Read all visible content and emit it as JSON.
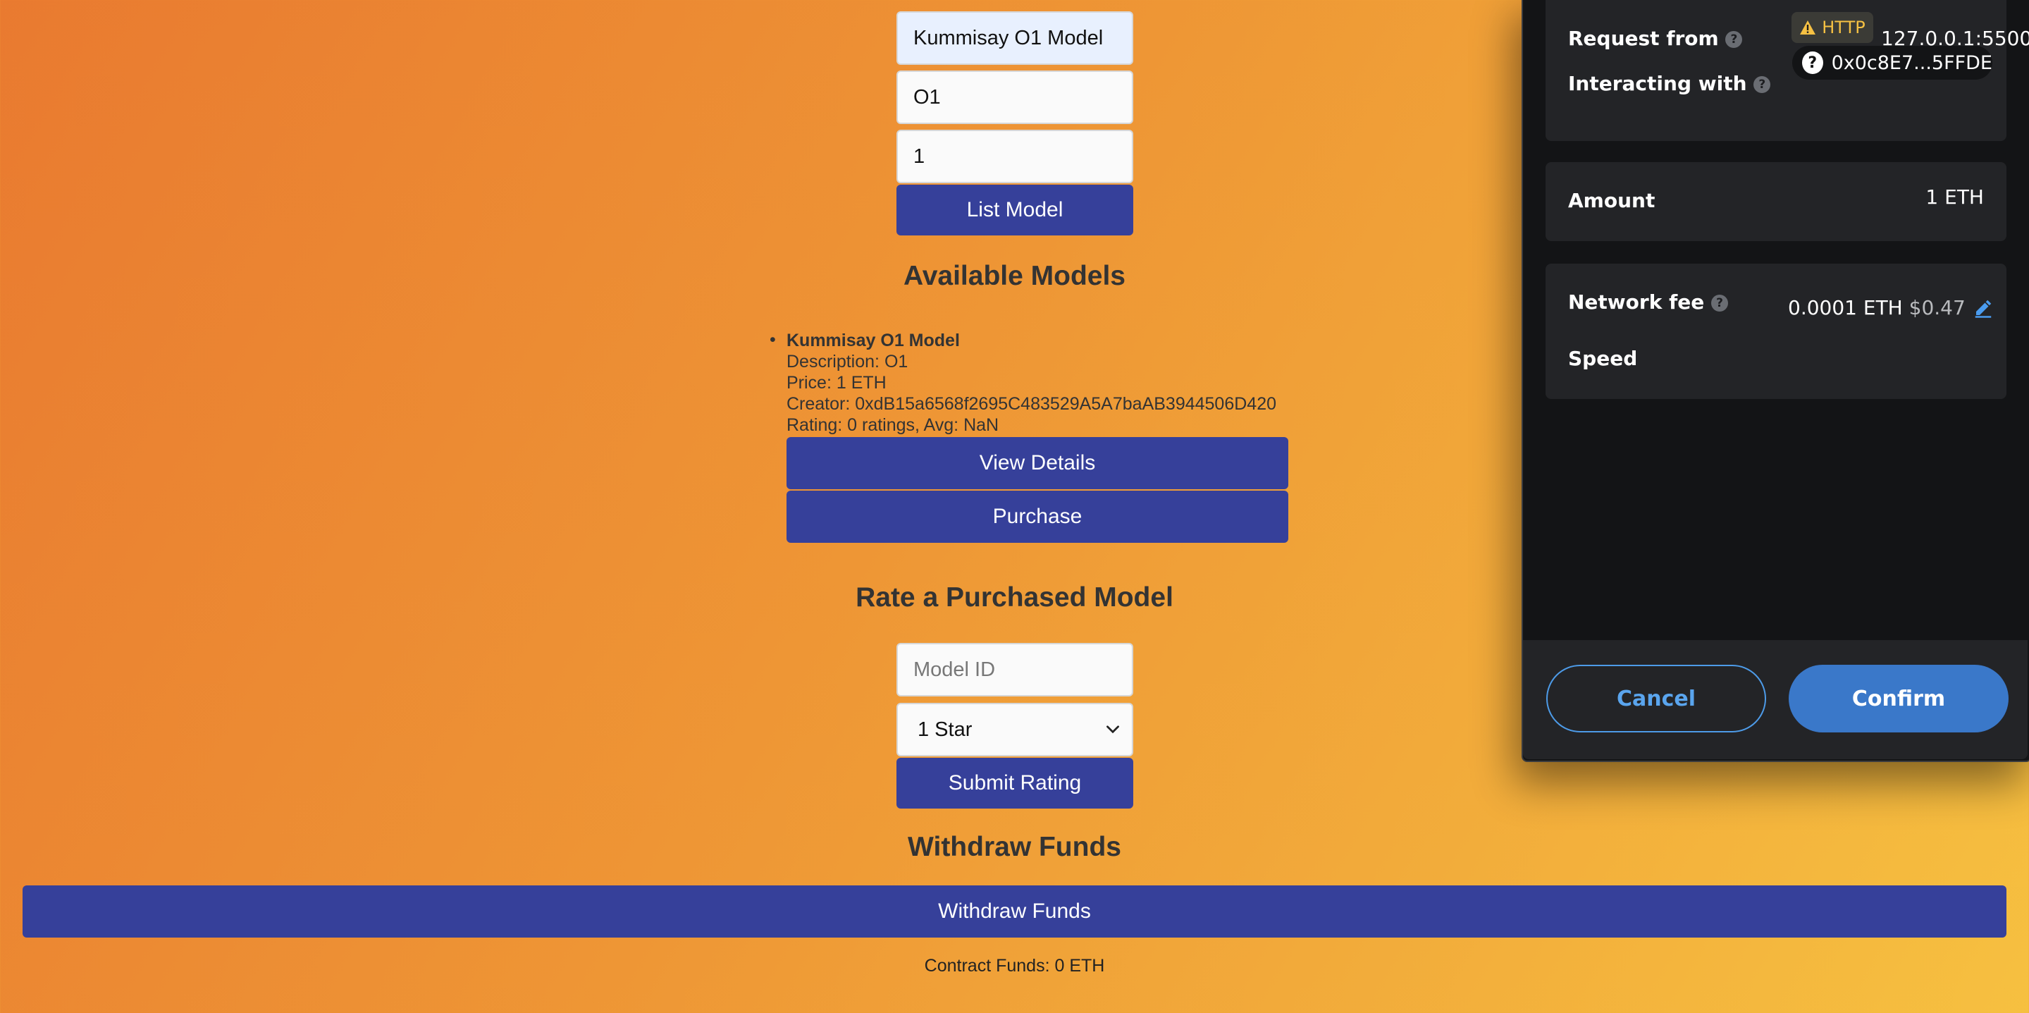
{
  "list_form": {
    "name_value": "Kummisay O1 Model",
    "description_value": "O1",
    "price_value": "1",
    "submit_label": "List Model"
  },
  "available": {
    "heading": "Available Models",
    "models": [
      {
        "name": "Kummisay O1 Model",
        "description": "Description: O1",
        "price": "Price: 1 ETH",
        "creator": "Creator: 0xdB15a6568f2695C483529A5A7baAB3944506D420",
        "rating": "Rating: 0 ratings, Avg: NaN",
        "details_label": "View Details",
        "purchase_label": "Purchase"
      }
    ]
  },
  "rate": {
    "heading": "Rate a Purchased Model",
    "model_id_placeholder": "Model ID",
    "star_selected": "1 Star",
    "submit_label": "Submit Rating"
  },
  "withdraw": {
    "heading": "Withdraw Funds",
    "button_label": "Withdraw Funds",
    "contract_funds": "Contract Funds: 0 ETH"
  },
  "wallet": {
    "request_from_label": "Request from",
    "http_badge": "HTTP",
    "request_from_value": "127.0.0.1:5500",
    "interacting_with_label": "Interacting with",
    "interacting_with_value": "0x0c8E7...5FFDE",
    "amount_label": "Amount",
    "amount_value": "1 ETH",
    "network_fee_label": "Network fee",
    "network_fee_eth": "0.0001 ETH",
    "network_fee_usd": "$0.47",
    "speed_label": "Speed",
    "cancel_label": "Cancel",
    "confirm_label": "Confirm",
    "accent_color": "#3a78c9",
    "warning_color": "#f6c143"
  }
}
